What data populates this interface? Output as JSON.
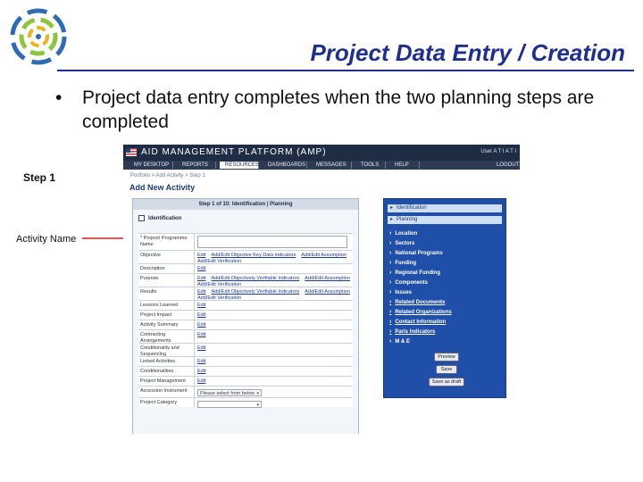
{
  "slide": {
    "title": "Project Data Entry / Creation",
    "bullet": "Project data entry completes when the two planning steps are completed",
    "step_label": "Step 1",
    "field_callout": "Activity Name"
  },
  "colors": {
    "title": "#1f2f8f",
    "amp_header": "#1e2c44",
    "sidebar": "#1f4fa8",
    "arrow": "#d22020"
  },
  "amp": {
    "title": "AID MANAGEMENT PLATFORM (AMP)",
    "header_right": "User  A T I  A T I",
    "menu": [
      "MY DESKTOP",
      "REPORTS",
      "RESOURCES",
      "DASHBOARDS",
      "MESSAGES",
      "TOOLS",
      "HELP"
    ],
    "logout": "LOGOUT",
    "breadcrumb": "Portfolio  >  Add Activity  >  Step 1",
    "page_title": "Add New Activity",
    "form_header": "Step 1 of 10: Identification | Planning",
    "section": "Identification",
    "fields": [
      {
        "label": "* Project/ Programme Name",
        "kind": "input"
      },
      {
        "label": "Objective",
        "kind": "links",
        "links": [
          "Edit",
          "Add/Edit Objective Key Data Indicators",
          "Add/Edit Assumption"
        ],
        "links2": [
          "Add/Edit Verification"
        ]
      },
      {
        "label": "Description",
        "kind": "links",
        "links": [
          "Edit"
        ],
        "links2": []
      },
      {
        "label": "Purpose",
        "kind": "links",
        "links": [
          "Edit",
          "Add/Edit Objectively Verifiable Indicators",
          "Add/Edit Assumption"
        ],
        "links2": [
          "Add/Edit Verification"
        ]
      },
      {
        "label": "Results",
        "kind": "links",
        "links": [
          "Edit",
          "Add/Edit Objectively Verifiable Indicators",
          "Add/Edit Assumption"
        ],
        "links2": [
          "Add/Edit Verification"
        ]
      },
      {
        "label": "Lessons Learned",
        "kind": "links",
        "links": [
          "Edit"
        ],
        "links2": []
      },
      {
        "label": "Project Impact",
        "kind": "links",
        "links": [
          "Edit"
        ],
        "links2": []
      },
      {
        "label": "Activity Summary",
        "kind": "links",
        "links": [
          "Edit"
        ],
        "links2": []
      },
      {
        "label": "Contracting Arrangements",
        "kind": "links",
        "links": [
          "Edit"
        ],
        "links2": []
      },
      {
        "label": "Conditionality and Sequencing",
        "kind": "links",
        "links": [
          "Edit"
        ],
        "links2": []
      },
      {
        "label": "Linked Activities",
        "kind": "links",
        "links": [
          "Edit"
        ],
        "links2": []
      },
      {
        "label": "Conditionalities",
        "kind": "links",
        "links": [
          "Edit"
        ],
        "links2": []
      },
      {
        "label": "Project Management",
        "kind": "links",
        "links": [
          "Edit"
        ],
        "links2": []
      },
      {
        "label": "Accession Instrument",
        "kind": "select",
        "value": "Please select from below"
      },
      {
        "label": "Project Category",
        "kind": "select",
        "value": ""
      }
    ],
    "sidebar_tabs": [
      "Identification",
      "Planning"
    ],
    "sidebar_nav": [
      "Location",
      "Sectors",
      "National Programs",
      "Funding",
      "Regional Funding",
      "Components",
      "Issues",
      "Related Documents",
      "Related Organizations",
      "Contact Information",
      "Paris Indicators",
      "M & E"
    ],
    "buttons": [
      "Preview",
      "Save",
      "Save as draft"
    ]
  }
}
